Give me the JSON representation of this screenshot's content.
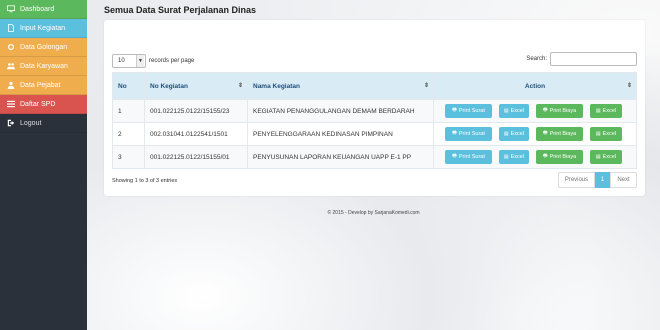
{
  "sidebar": {
    "items": [
      {
        "label": "Dashboard",
        "icon": "monitor-icon"
      },
      {
        "label": "Input Kegiatan",
        "icon": "document-icon"
      },
      {
        "label": "Data Golongan",
        "icon": "settings-icon"
      },
      {
        "label": "Data Karyawan",
        "icon": "users-icon"
      },
      {
        "label": "Data Pejabat",
        "icon": "user-icon"
      },
      {
        "label": "Daftar SPD",
        "icon": "list-icon"
      },
      {
        "label": "Logout",
        "icon": "logout-icon"
      }
    ]
  },
  "page": {
    "title": "Semua Data Surat Perjalanan Dinas"
  },
  "table_controls": {
    "length_value": "10",
    "length_suffix": "records per page",
    "search_label": "Search:",
    "search_value": ""
  },
  "table": {
    "headers": [
      "No",
      "No Kegiatan",
      "Nama Kegiatan",
      "Action"
    ],
    "rows": [
      {
        "no": "1",
        "no_kegiatan": "001.022125.0122/15155/23",
        "nama": "KEGIATAN PENANGGULANGAN DEMAM BERDARAH"
      },
      {
        "no": "2",
        "no_kegiatan": "002.031041.0122541/1501",
        "nama": "PENYELENGGARAAN KEDINASAN PIMPINAN"
      },
      {
        "no": "3",
        "no_kegiatan": "001.022125.0122/15155/01",
        "nama": "PENYUSUNAN LAPORAN KEUANGAN UAPP E-1 PP"
      }
    ],
    "actions": {
      "print_surat": "Print Surat",
      "excel": "Excel",
      "print_biaya": "Print Biaya"
    }
  },
  "footer": {
    "info": "Showing 1 to 3 of 3 entries",
    "prev": "Previous",
    "page": "1",
    "next": "Next",
    "copyright": "© 2015 - Develop by SarjanaKomedi.com"
  },
  "colors": {
    "sidebar": "#2a313b",
    "green": "#5cb85c",
    "blue": "#5bc0de",
    "orange": "#f0ad4e",
    "red": "#d9534f",
    "header": "#d9ebf5"
  }
}
